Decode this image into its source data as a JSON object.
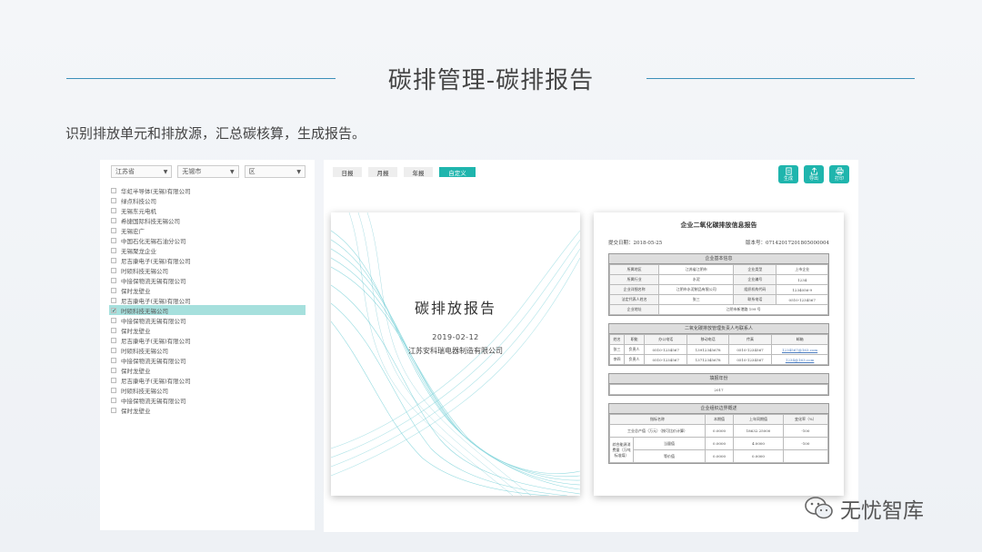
{
  "title": "碳排管理-碳排报告",
  "subtitle": "识别排放单元和排放源，汇总碳核算，生成报告。",
  "filters": {
    "province": "江苏省",
    "city": "无锡市",
    "district": "区"
  },
  "tree_items": [
    {
      "label": "华虹半导体(无锡)有限公司",
      "checked": false
    },
    {
      "label": "绿点科技公司",
      "checked": false
    },
    {
      "label": "无锡东元电机",
      "checked": false
    },
    {
      "label": "希捷国际科技无锡公司",
      "checked": false
    },
    {
      "label": "无锡宏广",
      "checked": false
    },
    {
      "label": "中国石化无锡石油分公司",
      "checked": false
    },
    {
      "label": "无锡聚龙企业",
      "checked": false
    },
    {
      "label": "尼吉康电子(无锡)有限公司",
      "checked": false
    },
    {
      "label": "时硕科技无锡公司",
      "checked": false
    },
    {
      "label": "中接保物流无锡有限公司",
      "checked": false
    },
    {
      "label": "保时龙壁业",
      "checked": false
    },
    {
      "label": "尼吉康电子(无锡)有限公司",
      "checked": false
    },
    {
      "label": "时硕科技无锡公司",
      "checked": true
    },
    {
      "label": "中接保物流无锡有限公司",
      "checked": false
    },
    {
      "label": "保时龙壁业",
      "checked": false
    },
    {
      "label": "尼吉康电子(无锡)有限公司",
      "checked": false
    },
    {
      "label": "时硕科技无锡公司",
      "checked": false
    },
    {
      "label": "中接保物流无锡有限公司",
      "checked": false
    },
    {
      "label": "保时龙壁业",
      "checked": false
    },
    {
      "label": "尼吉康电子(无锡)有限公司",
      "checked": false
    },
    {
      "label": "时硕科技无锡公司",
      "checked": false
    },
    {
      "label": "中接保物流无锡有限公司",
      "checked": false
    },
    {
      "label": "保时龙壁业",
      "checked": false
    }
  ],
  "tabs": [
    "日报",
    "月报",
    "年报",
    "自定义"
  ],
  "active_tab": "自定义",
  "actions": {
    "generate": "生成",
    "export": "导出",
    "print": "打印"
  },
  "cover": {
    "title": "碳排放报告",
    "date": "2019-02-12",
    "company": "江苏安科瑞电器制造有限公司"
  },
  "report": {
    "heading": "企业二氧化碳排放信息报告",
    "submit_date": "提交日期：2018-05-25",
    "version": "版本号：07142017201805000004",
    "basic": {
      "header": "企业基本信息",
      "rows": [
        [
          "所属地区",
          "江苏省江阴市",
          "企业类型",
          "上市企业"
        ],
        [
          "所属行业",
          "水泥",
          "企业编号",
          "1234"
        ],
        [
          "企业详细名称",
          "江阴市水泥制品有限公司",
          "组织机构代码",
          "1234056-9"
        ],
        [
          "法定代表人姓名",
          "张三",
          "联系电话",
          "0510-1234567"
        ]
      ],
      "address_label": "企业地址",
      "address": "江阴市新港路 199 号"
    },
    "contacts": {
      "header": "二氧化碳排放管理负责人与联系人",
      "columns": [
        "姓名",
        "职能",
        "办公电话",
        "移动电话",
        "传真",
        "邮箱"
      ],
      "rows": [
        [
          "张三",
          "负责人",
          "0510-1234567",
          "13912345678",
          "0510-1234567",
          "1234567@163.com"
        ],
        [
          "李四",
          "负责人",
          "0510-1234567",
          "13712345678",
          "0510-1234567",
          "1234@163.com"
        ]
      ]
    },
    "year": {
      "header": "填报年份",
      "value": "2017"
    },
    "profile": {
      "header": "企业组织边界概述",
      "columns": [
        "指标名称",
        "",
        "本期值",
        "上年同期值",
        "变化率（%）"
      ],
      "output_label": "工业总产值（万元）（按可比价计算）",
      "output": [
        "0.0000",
        "18632.25000",
        "-100"
      ],
      "energy_label": "综合能源消费量（万吨标准煤）",
      "energy_rows": [
        [
          "当量值",
          "0.0000",
          "4.0000",
          "-100"
        ],
        [
          "等价值",
          "0.0000",
          "0.0000",
          ""
        ]
      ]
    }
  },
  "watermark": "无忧智库"
}
